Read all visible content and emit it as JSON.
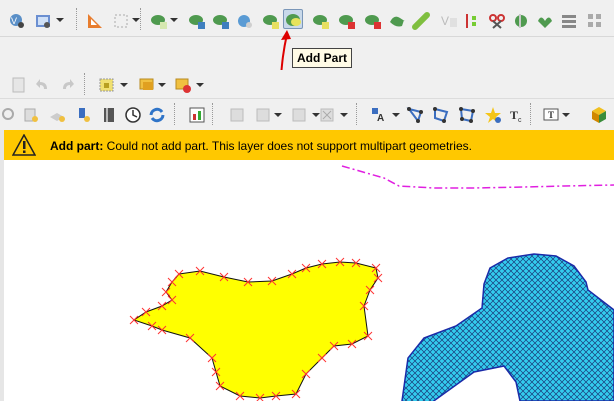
{
  "tooltip": {
    "label": "Add Part"
  },
  "message": {
    "title": "Add part:",
    "text": "Could not add part. This layer does not support multipart geometries."
  },
  "colors": {
    "message_bg": "#ffc800",
    "polygon_fill": "#ffff00",
    "hatched_fill": "#33ccee",
    "vertex_marker": "#ff3333",
    "line_layer": "#e020e0",
    "pointer_arrow": "#dd0000"
  },
  "icons": {
    "row1": [
      "digitize-mode-icon",
      "settings-table-icon",
      "measure-angle-icon",
      "select-rect-icon",
      "add-ring-icon",
      "reshape-icon",
      "move-node-icon",
      "delete-node-icon",
      "add-ring-2-icon",
      "add-part-icon",
      "fill-ring-icon",
      "delete-ring-icon",
      "delete-part-icon",
      "simplify-icon",
      "offset-curve-icon",
      "split-feature-icon",
      "split-parts-icon",
      "merge-icon",
      "rotate-icon",
      "merge-attributes-icon"
    ],
    "row2": [
      "new-layer-icon",
      "undo-icon",
      "redo-icon",
      "select-features-icon",
      "deselect-icon",
      "delete-selected-icon"
    ],
    "row3": [
      "pan-icon",
      "new-layer-2-icon",
      "add-layer-icon",
      "pin-icon",
      "bookmark-icon",
      "clock-icon",
      "refresh-icon",
      "map-tips-icon",
      "label-tool-icon",
      "diagram-icon",
      "label-style-icon",
      "node-tool-icon",
      "vertex-icon",
      "star-icon",
      "text-tool-icon",
      "annotation-icon",
      "3d-box-icon"
    ]
  }
}
